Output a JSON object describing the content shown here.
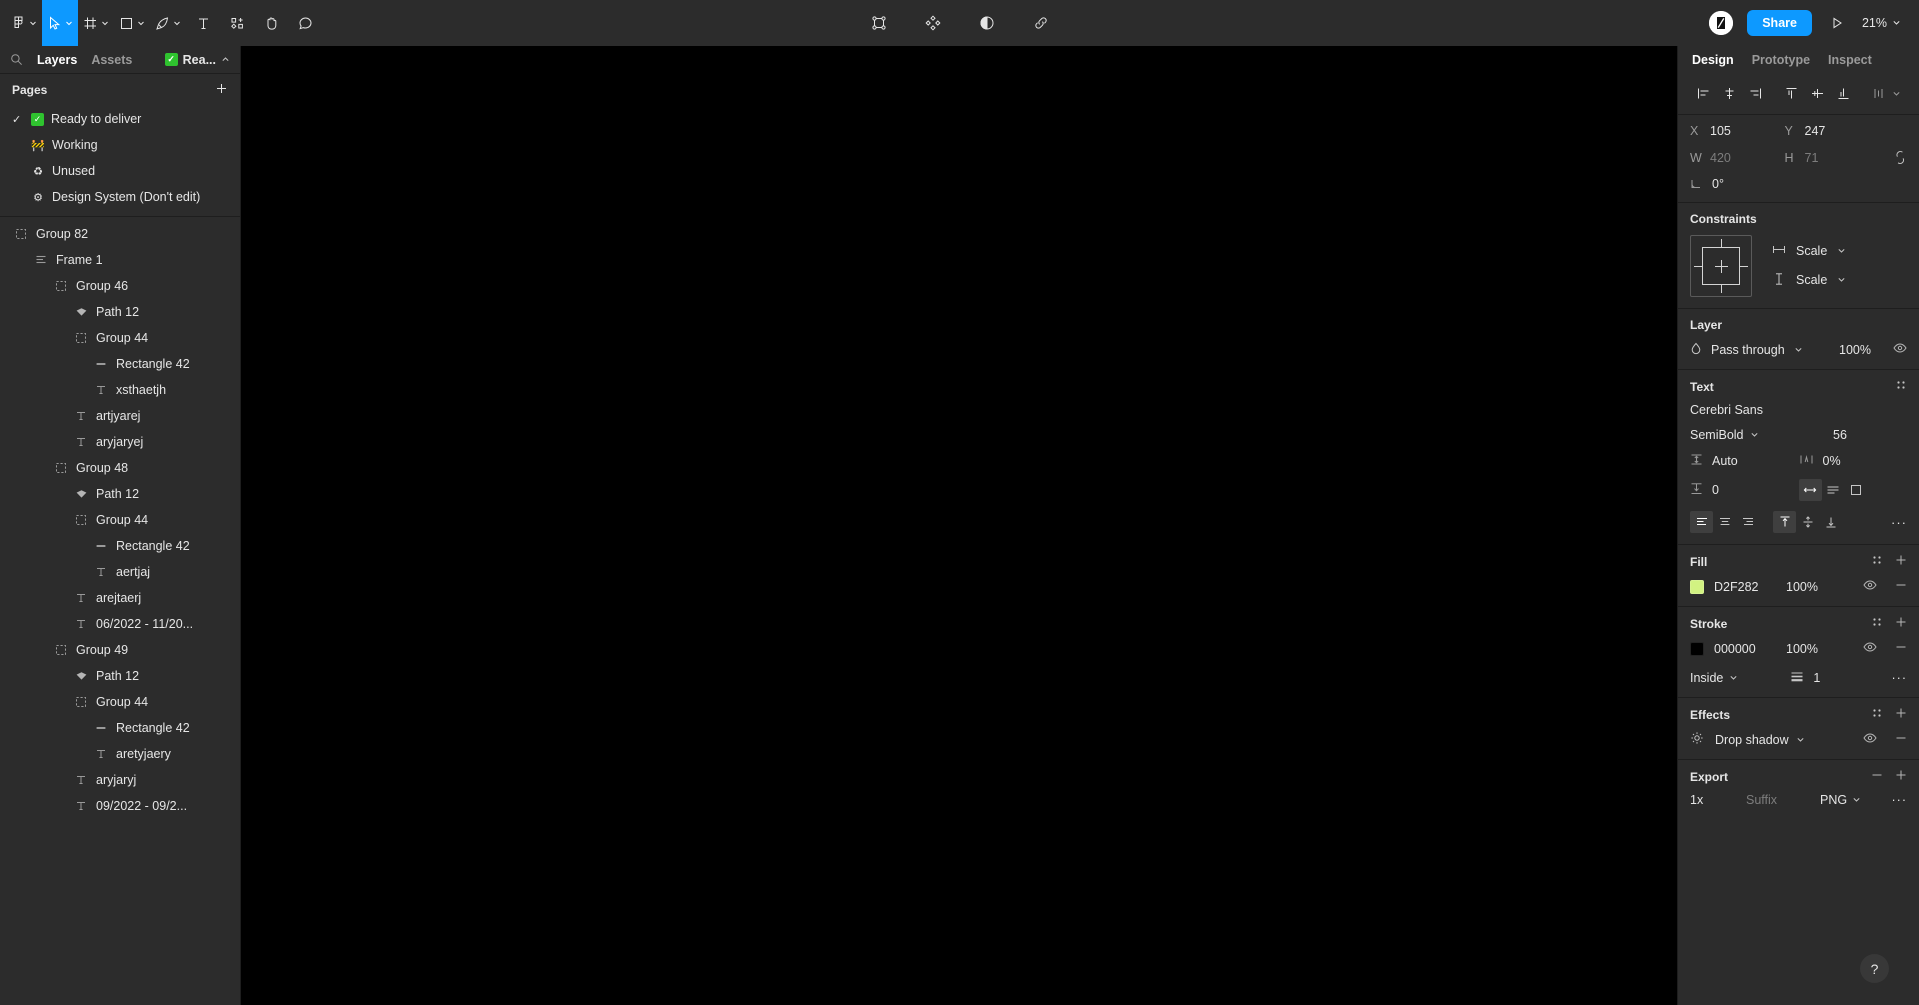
{
  "toolbar": {
    "left_tools": [
      {
        "name": "figma-menu",
        "icon": "figma-logo",
        "caret": true,
        "active": false
      },
      {
        "name": "move-tool",
        "icon": "cursor",
        "caret": true,
        "active": true
      },
      {
        "name": "frame-tool",
        "icon": "frame",
        "caret": true,
        "active": false
      },
      {
        "name": "shape-tool",
        "icon": "square",
        "caret": true,
        "active": false
      },
      {
        "name": "pen-tool",
        "icon": "pen",
        "caret": true,
        "active": false
      },
      {
        "name": "text-tool",
        "icon": "text",
        "caret": false,
        "active": false
      },
      {
        "name": "resources-tool",
        "icon": "components",
        "caret": false,
        "active": false
      },
      {
        "name": "hand-tool",
        "icon": "hand",
        "caret": false,
        "active": false
      },
      {
        "name": "comment-tool",
        "icon": "comment",
        "caret": false,
        "active": false
      }
    ],
    "center_tools": [
      {
        "name": "selection-bounds",
        "icon": "bounding-box"
      },
      {
        "name": "components",
        "icon": "four-diamonds"
      },
      {
        "name": "contrast",
        "icon": "half-circle"
      },
      {
        "name": "link",
        "icon": "chain-link"
      }
    ],
    "share_label": "Share",
    "present_icon": "play-triangle",
    "zoom_level": "21%",
    "avatar_icon": "user-avatar"
  },
  "left_panel": {
    "search_icon": "search-icon",
    "tabs": [
      {
        "label": "Layers",
        "active": true
      },
      {
        "label": "Assets",
        "active": false
      }
    ],
    "current_page_pill": {
      "emoji": "check",
      "label": "Rea..."
    },
    "pages_title": "Pages",
    "add_page_icon": "plus-icon",
    "pages": [
      {
        "label": "Ready to deliver",
        "emoji": "check",
        "selected": true
      },
      {
        "label": "Working",
        "emoji": "🚧",
        "selected": false
      },
      {
        "label": "Unused",
        "emoji": "♻",
        "selected": false
      },
      {
        "label": "Design System (Don't edit)",
        "emoji": "⚙",
        "selected": false
      }
    ],
    "layers": [
      {
        "label": "Group 82",
        "icon": "group",
        "depth": 0
      },
      {
        "label": "Frame 1",
        "icon": "frame",
        "depth": 1
      },
      {
        "label": "Group 46",
        "icon": "group",
        "depth": 2
      },
      {
        "label": "Path 12",
        "icon": "vector",
        "depth": 3
      },
      {
        "label": "Group 44",
        "icon": "group",
        "depth": 3
      },
      {
        "label": "Rectangle 42",
        "icon": "rectangle",
        "depth": 4
      },
      {
        "label": "xsthaetjh",
        "icon": "text",
        "depth": 4
      },
      {
        "label": "artjyarej",
        "icon": "text",
        "depth": 3
      },
      {
        "label": "aryjaryej",
        "icon": "text",
        "depth": 3
      },
      {
        "label": "Group 48",
        "icon": "group",
        "depth": 2
      },
      {
        "label": "Path 12",
        "icon": "vector",
        "depth": 3
      },
      {
        "label": "Group 44",
        "icon": "group",
        "depth": 3
      },
      {
        "label": "Rectangle 42",
        "icon": "rectangle",
        "depth": 4
      },
      {
        "label": "aertjaj",
        "icon": "text",
        "depth": 4
      },
      {
        "label": "arejtaerj",
        "icon": "text",
        "depth": 3
      },
      {
        "label": "06/2022 - 11/20...",
        "icon": "text",
        "depth": 3
      },
      {
        "label": "Group 49",
        "icon": "group",
        "depth": 2
      },
      {
        "label": "Path 12",
        "icon": "vector",
        "depth": 3
      },
      {
        "label": "Group 44",
        "icon": "group",
        "depth": 3
      },
      {
        "label": "Rectangle 42",
        "icon": "rectangle",
        "depth": 4
      },
      {
        "label": "aretyjaery",
        "icon": "text",
        "depth": 4
      },
      {
        "label": "aryjaryj",
        "icon": "text",
        "depth": 3
      },
      {
        "label": "09/2022 - 09/2...",
        "icon": "text",
        "depth": 3
      }
    ]
  },
  "right_panel": {
    "tabs": [
      {
        "label": "Design",
        "active": true
      },
      {
        "label": "Prototype",
        "active": false
      },
      {
        "label": "Inspect",
        "active": false
      }
    ],
    "align_buttons": [
      "align-left",
      "align-horizontal-center",
      "align-right",
      "align-top",
      "align-vertical-center",
      "align-bottom",
      "distribute-menu"
    ],
    "position": {
      "x_label": "X",
      "x_value": "105",
      "y_label": "Y",
      "y_value": "247",
      "w_label": "W",
      "w_value": "420",
      "h_label": "H",
      "h_value": "71",
      "rotation_value": "0°",
      "constrain_proportions_icon": "link-broken-icon"
    },
    "constraints": {
      "title": "Constraints",
      "horizontal": "Scale",
      "vertical": "Scale"
    },
    "layer": {
      "title": "Layer",
      "blend_mode": "Pass through",
      "opacity": "100%",
      "visibility_icon": "eye-icon"
    },
    "text": {
      "title": "Text",
      "font_family": "Cerebri Sans",
      "font_weight": "SemiBold",
      "font_size": "56",
      "line_height": "Auto",
      "letter_spacing": "0%",
      "paragraph_spacing": "0",
      "resize_mode_icon": "auto-width-icon",
      "align_h_active": "left",
      "align_v_active": "top",
      "more_icon": "more-options-icon"
    },
    "fill": {
      "title": "Fill",
      "color_hex": "D2F282",
      "color_value": "#D2F282",
      "opacity": "100%"
    },
    "stroke": {
      "title": "Stroke",
      "color_hex": "000000",
      "color_value": "#000000",
      "opacity": "100%",
      "position": "Inside",
      "weight": "1"
    },
    "effects": {
      "title": "Effects",
      "effect_name": "Drop shadow"
    },
    "export": {
      "title": "Export",
      "scale": "1x",
      "suffix_placeholder": "Suffix",
      "format": "PNG"
    }
  },
  "help_button": {
    "label": "?"
  },
  "colors": {
    "accent": "#0d99ff",
    "panel_bg": "#2c2c2c",
    "canvas_bg": "#000000",
    "divider": "#1e1e1e",
    "text_primary": "#e6e6e6",
    "text_muted": "#9a9a9a"
  }
}
